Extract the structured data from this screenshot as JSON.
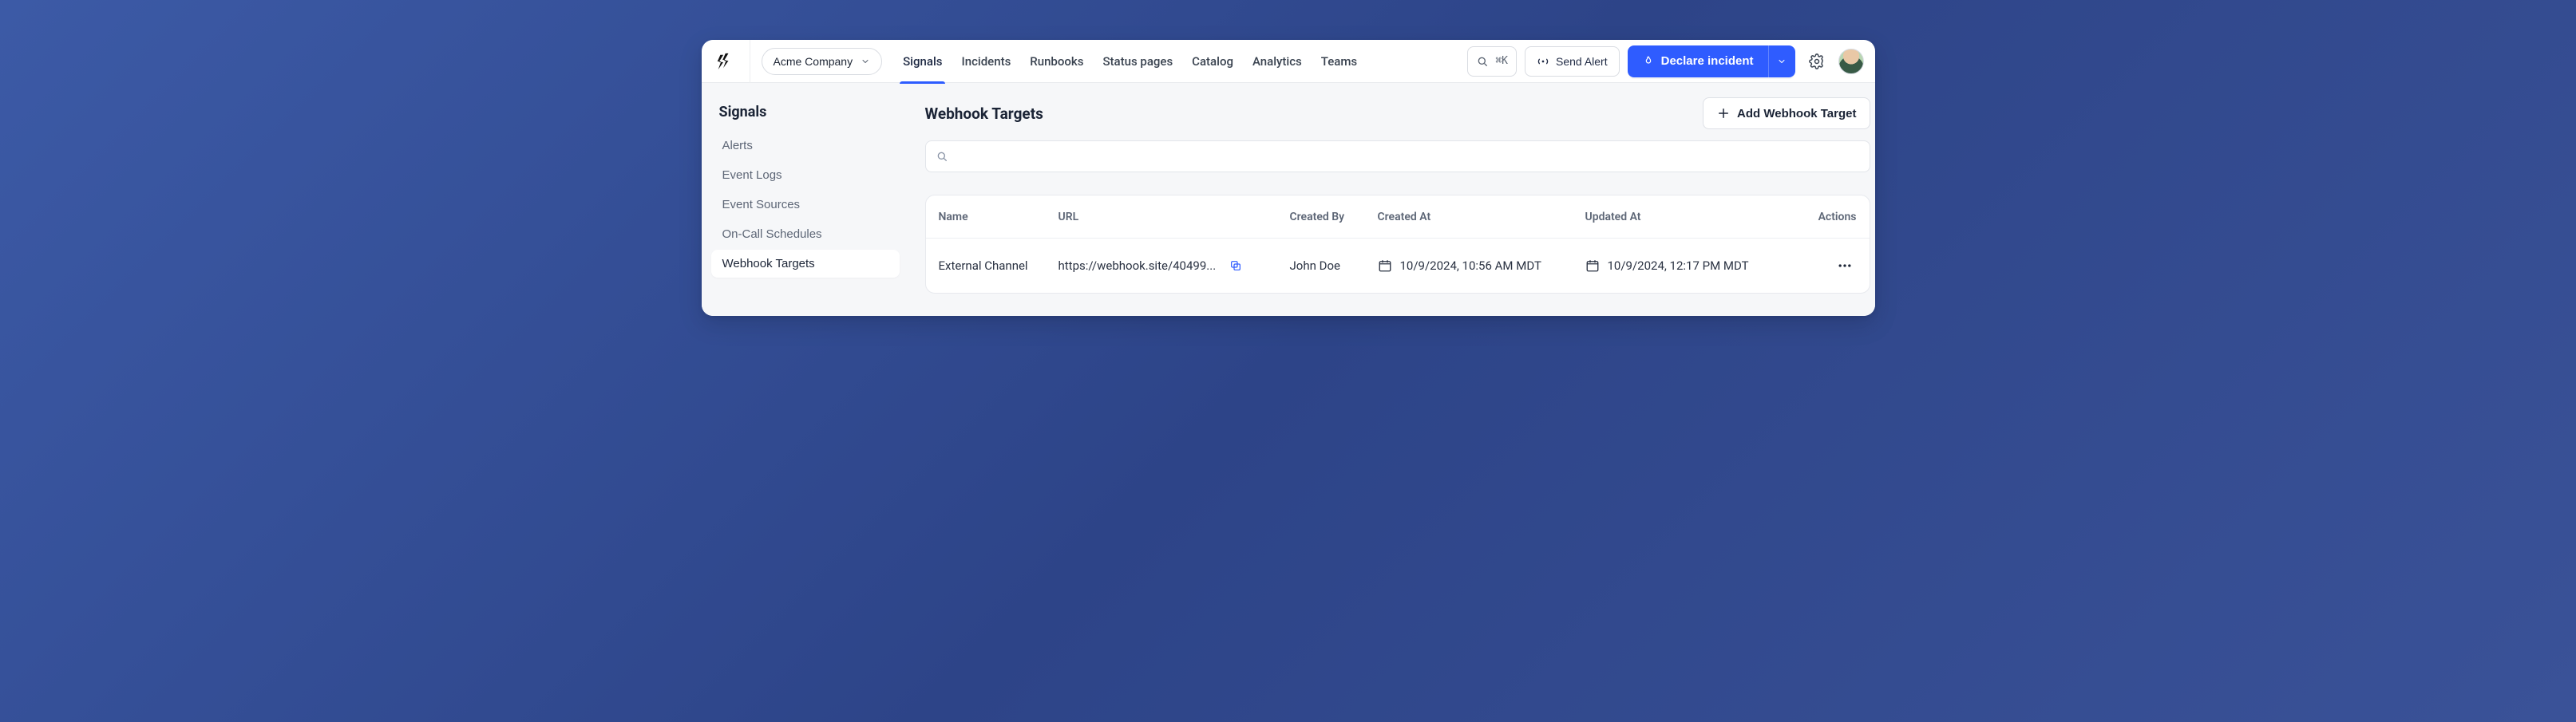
{
  "org": {
    "name": "Acme Company"
  },
  "nav": {
    "items": [
      "Signals",
      "Incidents",
      "Runbooks",
      "Status pages",
      "Catalog",
      "Analytics",
      "Teams"
    ],
    "activeIndex": 0
  },
  "topbar": {
    "searchShortcut": "⌘K",
    "sendAlert": "Send Alert",
    "declare": "Declare incident"
  },
  "sidebar": {
    "title": "Signals",
    "items": [
      "Alerts",
      "Event Logs",
      "Event Sources",
      "On-Call Schedules",
      "Webhook Targets"
    ],
    "activeIndex": 4
  },
  "page": {
    "title": "Webhook Targets",
    "addButton": "Add Webhook Target",
    "searchPlaceholder": ""
  },
  "table": {
    "columns": [
      "Name",
      "URL",
      "Created By",
      "Created At",
      "Updated At",
      "Actions"
    ],
    "rows": [
      {
        "name": "External Channel",
        "url": "https://webhook.site/40499...",
        "createdBy": "John Doe",
        "createdAt": "10/9/2024, 10:56 AM MDT",
        "updatedAt": "10/9/2024, 12:17 PM MDT"
      }
    ]
  },
  "colors": {
    "primary": "#2f5cff"
  }
}
